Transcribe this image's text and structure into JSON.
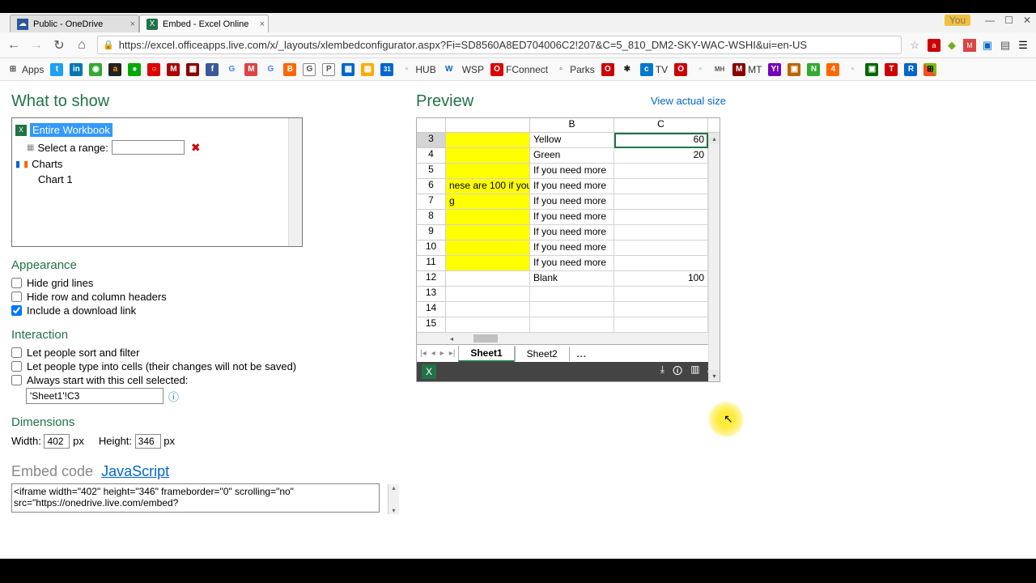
{
  "tabs": {
    "t1": "Public - OneDrive",
    "t2": "Embed - Excel Online"
  },
  "you_label": "You",
  "url": "https://excel.officeapps.live.com/x/_layouts/xlembedconfigurator.aspx?Fi=SD8560A8ED704006C2!207&C=5_810_DM2-SKY-WAC-WSHI&ui=en-US",
  "bookmarks": {
    "apps": "Apps",
    "hub": "HUB",
    "wsp": "WSP",
    "fconnect": "FConnect",
    "parks": "Parks",
    "tv": "TV",
    "mt": "MT"
  },
  "left": {
    "what_to_show": "What to show",
    "entire_workbook": "Entire Workbook",
    "select_range": "Select a range:",
    "charts": "Charts",
    "chart1": "Chart 1",
    "appearance": "Appearance",
    "hide_grid": "Hide grid lines",
    "hide_headers": "Hide row and column headers",
    "include_download": "Include a download link",
    "interaction": "Interaction",
    "let_sort": "Let people sort and filter",
    "let_type": "Let people type into cells (their changes will not be saved)",
    "always_start": "Always start with this cell selected:",
    "start_cell": "'Sheet1'!C3",
    "dimensions": "Dimensions",
    "width_lbl": "Width:",
    "width_val": "402",
    "height_lbl": "Height:",
    "height_val": "346",
    "px": "px",
    "embed_code": "Embed code",
    "javascript": "JavaScript",
    "embed_text": "<iframe width=\"402\" height=\"346\" frameborder=\"0\" scrolling=\"no\" src=\"https://onedrive.live.com/embed?"
  },
  "right": {
    "preview": "Preview",
    "view_actual": "View actual size",
    "col_b": "B",
    "col_c": "C",
    "rows": [
      {
        "n": "3",
        "a": "",
        "b": "Yellow",
        "c": "60",
        "sel": true
      },
      {
        "n": "4",
        "a": "",
        "b": "Green",
        "c": "20"
      },
      {
        "n": "5",
        "a": "",
        "b": "If you need more",
        "c": ""
      },
      {
        "n": "6",
        "a": "nese are 100 if you",
        "b": "If you need more",
        "c": ""
      },
      {
        "n": "7",
        "a": "g",
        "b": "If you need more",
        "c": ""
      },
      {
        "n": "8",
        "a": "",
        "b": "If you need more",
        "c": ""
      },
      {
        "n": "9",
        "a": "",
        "b": "If you need more",
        "c": ""
      },
      {
        "n": "10",
        "a": "",
        "b": "If you need more",
        "c": ""
      },
      {
        "n": "11",
        "a": "",
        "b": "If you need more",
        "c": ""
      },
      {
        "n": "12",
        "a": "",
        "b": "Blank",
        "c": "100"
      },
      {
        "n": "13",
        "a": "",
        "b": "",
        "c": ""
      },
      {
        "n": "14",
        "a": "",
        "b": "",
        "c": ""
      },
      {
        "n": "15",
        "a": "",
        "b": "",
        "c": ""
      }
    ],
    "sheet1": "Sheet1",
    "sheet2": "Sheet2"
  }
}
